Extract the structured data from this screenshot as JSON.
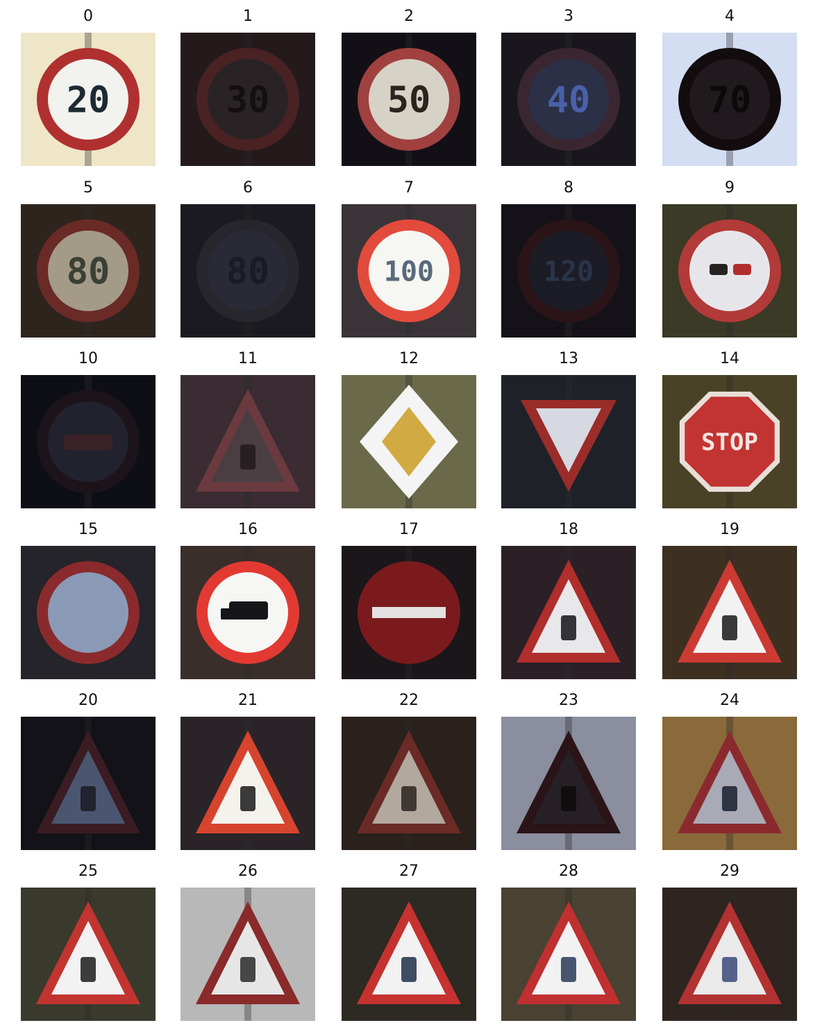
{
  "tiles": [
    {
      "label": "0",
      "bg": "#efe6c8",
      "shape": "circle",
      "ring": "#b03030",
      "face": "#f2f2ee",
      "text": "20",
      "textColor": "#1e2a33",
      "fg": "#000000"
    },
    {
      "label": "1",
      "bg": "#241a1c",
      "shape": "circle",
      "ring": "#4a2224",
      "face": "#2a2326",
      "text": "30",
      "textColor": "#141012",
      "fg": "#000000"
    },
    {
      "label": "2",
      "bg": "#121016",
      "shape": "circle",
      "ring": "#a0413f",
      "face": "#d6d2c6",
      "text": "50",
      "textColor": "#2a2420",
      "fg": "#000000"
    },
    {
      "label": "3",
      "bg": "#19171d",
      "shape": "circle",
      "ring": "#3a2630",
      "face": "#2b3046",
      "text": "40",
      "textColor": "#4a60a8",
      "fg": "#000000"
    },
    {
      "label": "4",
      "bg": "#d4def3",
      "shape": "circle",
      "ring": "#120c0f",
      "face": "#201a1e",
      "text": "70",
      "textColor": "#0b0909",
      "fg": "#000000"
    },
    {
      "label": "5",
      "bg": "#2e241e",
      "shape": "circle",
      "ring": "#6a2a26",
      "face": "#a49a88",
      "text": "80",
      "textColor": "#3a4034",
      "fg": "#000000"
    },
    {
      "label": "6",
      "bg": "#1a1a20",
      "shape": "circle",
      "ring": "#26262c",
      "face": "#2a2a36",
      "text": "80",
      "textColor": "#1a1b24",
      "fg": "#000000"
    },
    {
      "label": "7",
      "bg": "#3a3438",
      "shape": "circle",
      "ring": "#e24a3c",
      "face": "#f6f6f2",
      "text": "100",
      "textColor": "#5a6a7a",
      "fg": "#000000"
    },
    {
      "label": "8",
      "bg": "#141218",
      "shape": "circle",
      "ring": "#2a1418",
      "face": "#1c1c26",
      "text": "120",
      "textColor": "#2a3448",
      "fg": "#000000"
    },
    {
      "label": "9",
      "bg": "#3a3a26",
      "shape": "circle",
      "ring": "#b23a38",
      "face": "#e6e6ea",
      "text": "",
      "textColor": "#000000",
      "fg": "#262222"
    },
    {
      "label": "10",
      "bg": "#0e0e16",
      "shape": "circle",
      "ring": "#1c141a",
      "face": "#22222e",
      "text": "",
      "textColor": "#000000",
      "fg": "#3a2226"
    },
    {
      "label": "11",
      "bg": "#3a2c32",
      "shape": "triangle",
      "ring": "#6a3a3e",
      "face": "#4a3e42",
      "text": "",
      "textColor": "#000000",
      "fg": "#221a1c"
    },
    {
      "label": "12",
      "bg": "#6a6a4a",
      "shape": "diamond",
      "ring": "#f4f4f4",
      "face": "#d2aa44",
      "text": "",
      "textColor": "#000000",
      "fg": "#000000"
    },
    {
      "label": "13",
      "bg": "#1e2228",
      "shape": "inverted-triangle",
      "ring": "#9a2c2a",
      "face": "#d6d8e2",
      "text": "",
      "textColor": "#000000",
      "fg": "#000000"
    },
    {
      "label": "14",
      "bg": "#4a4226",
      "shape": "octagon",
      "ring": "#e8e0d8",
      "face": "#c23432",
      "text": "STOP",
      "textColor": "#f4e4e2",
      "fg": "#000000"
    },
    {
      "label": "15",
      "bg": "#24242a",
      "shape": "circle",
      "ring": "#8a2a2c",
      "face": "#8a9ab6",
      "text": "",
      "textColor": "#000000",
      "fg": "#000000"
    },
    {
      "label": "16",
      "bg": "#3a2e2a",
      "shape": "circle",
      "ring": "#e23a32",
      "face": "#f6f6f4",
      "text": "",
      "textColor": "#000000",
      "fg": "#16161a"
    },
    {
      "label": "17",
      "bg": "#1a161a",
      "shape": "circle",
      "ring": "#7a1a1c",
      "face": "#7a1a1c",
      "text": "",
      "textColor": "#000000",
      "fg": "#e4e0e2"
    },
    {
      "label": "18",
      "bg": "#2a2026",
      "shape": "triangle",
      "ring": "#b02e2c",
      "face": "#e8e8ea",
      "text": "",
      "textColor": "#000000",
      "fg": "#141416"
    },
    {
      "label": "19",
      "bg": "#3e3020",
      "shape": "triangle",
      "ring": "#cc3a34",
      "face": "#f2f2f2",
      "text": "",
      "textColor": "#000000",
      "fg": "#1a1a1c"
    },
    {
      "label": "20",
      "bg": "#121218",
      "shape": "triangle",
      "ring": "#3a1c22",
      "face": "#4a5670",
      "text": "",
      "textColor": "#000000",
      "fg": "#1a1a22"
    },
    {
      "label": "21",
      "bg": "#2a2428",
      "shape": "triangle",
      "ring": "#d6442e",
      "face": "#f4f2ec",
      "text": "",
      "textColor": "#000000",
      "fg": "#1a1a1a"
    },
    {
      "label": "22",
      "bg": "#2a201c",
      "shape": "triangle",
      "ring": "#6a2a26",
      "face": "#b2a89e",
      "text": "",
      "textColor": "#000000",
      "fg": "#2a2420"
    },
    {
      "label": "23",
      "bg": "#8a8e9e",
      "shape": "triangle",
      "ring": "#2a1418",
      "face": "#262026",
      "text": "",
      "textColor": "#000000",
      "fg": "#0e0a0c"
    },
    {
      "label": "24",
      "bg": "#8a6a3a",
      "shape": "triangle",
      "ring": "#8a2a2e",
      "face": "#aaaab6",
      "text": "",
      "textColor": "#000000",
      "fg": "#1a2030"
    },
    {
      "label": "25",
      "bg": "#3a3a2c",
      "shape": "triangle",
      "ring": "#c23430",
      "face": "#f2f2f2",
      "text": "",
      "textColor": "#000000",
      "fg": "#1c1c1e"
    },
    {
      "label": "26",
      "bg": "#b8b8b8",
      "shape": "triangle",
      "ring": "#8a2a2a",
      "face": "#e6e6e6",
      "text": "",
      "textColor": "#000000",
      "fg": "#2a2a2a"
    },
    {
      "label": "27",
      "bg": "#2c2a22",
      "shape": "triangle",
      "ring": "#c63230",
      "face": "#f2f2f2",
      "text": "",
      "textColor": "#000000",
      "fg": "#20304a"
    },
    {
      "label": "28",
      "bg": "#4a4232",
      "shape": "triangle",
      "ring": "#c03030",
      "face": "#f2f2f2",
      "text": "",
      "textColor": "#000000",
      "fg": "#2a3a5a"
    },
    {
      "label": "29",
      "bg": "#2e2420",
      "shape": "triangle",
      "ring": "#b23232",
      "face": "#eaeaea",
      "text": "",
      "textColor": "#000000",
      "fg": "#3a4a7a"
    }
  ]
}
